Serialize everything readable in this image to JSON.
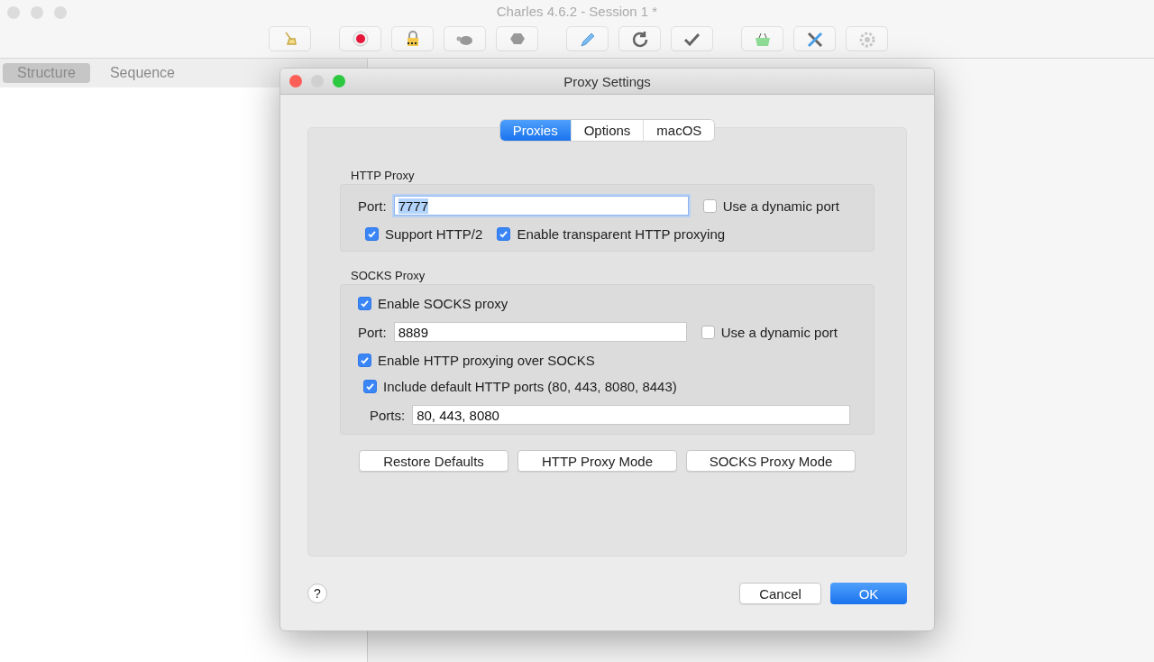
{
  "window": {
    "title": "Charles 4.6.2 - Session 1 *"
  },
  "view_tabs": [
    {
      "label": "Structure",
      "selected": true
    },
    {
      "label": "Sequence",
      "selected": false
    }
  ],
  "dialog": {
    "title": "Proxy Settings",
    "tabs": [
      {
        "label": "Proxies",
        "selected": true
      },
      {
        "label": "Options",
        "selected": false
      },
      {
        "label": "macOS",
        "selected": false
      }
    ],
    "http_proxy": {
      "title": "HTTP Proxy",
      "port_label": "Port:",
      "port_value": "7777",
      "dynamic_port": {
        "label": "Use a dynamic port",
        "checked": false
      },
      "options": [
        {
          "label": "Support HTTP/2",
          "checked": true
        },
        {
          "label": "Enable transparent HTTP proxying",
          "checked": true
        }
      ]
    },
    "socks_proxy": {
      "title": "SOCKS Proxy",
      "enable": {
        "label": "Enable SOCKS proxy",
        "checked": true
      },
      "port_label": "Port:",
      "port_value": "8889",
      "dynamic_port": {
        "label": "Use a dynamic port",
        "checked": false
      },
      "http_over_socks": {
        "label": "Enable HTTP proxying over SOCKS",
        "checked": true
      },
      "include_default_ports": {
        "label": "Include default HTTP ports (80, 443, 8080, 8443)",
        "checked": true
      },
      "ports_label": "Ports:",
      "ports_value": "80, 443, 8080"
    },
    "mode_buttons": [
      "Restore Defaults",
      "HTTP Proxy Mode",
      "SOCKS Proxy Mode"
    ],
    "help": "?",
    "cancel": "Cancel",
    "ok": "OK"
  }
}
